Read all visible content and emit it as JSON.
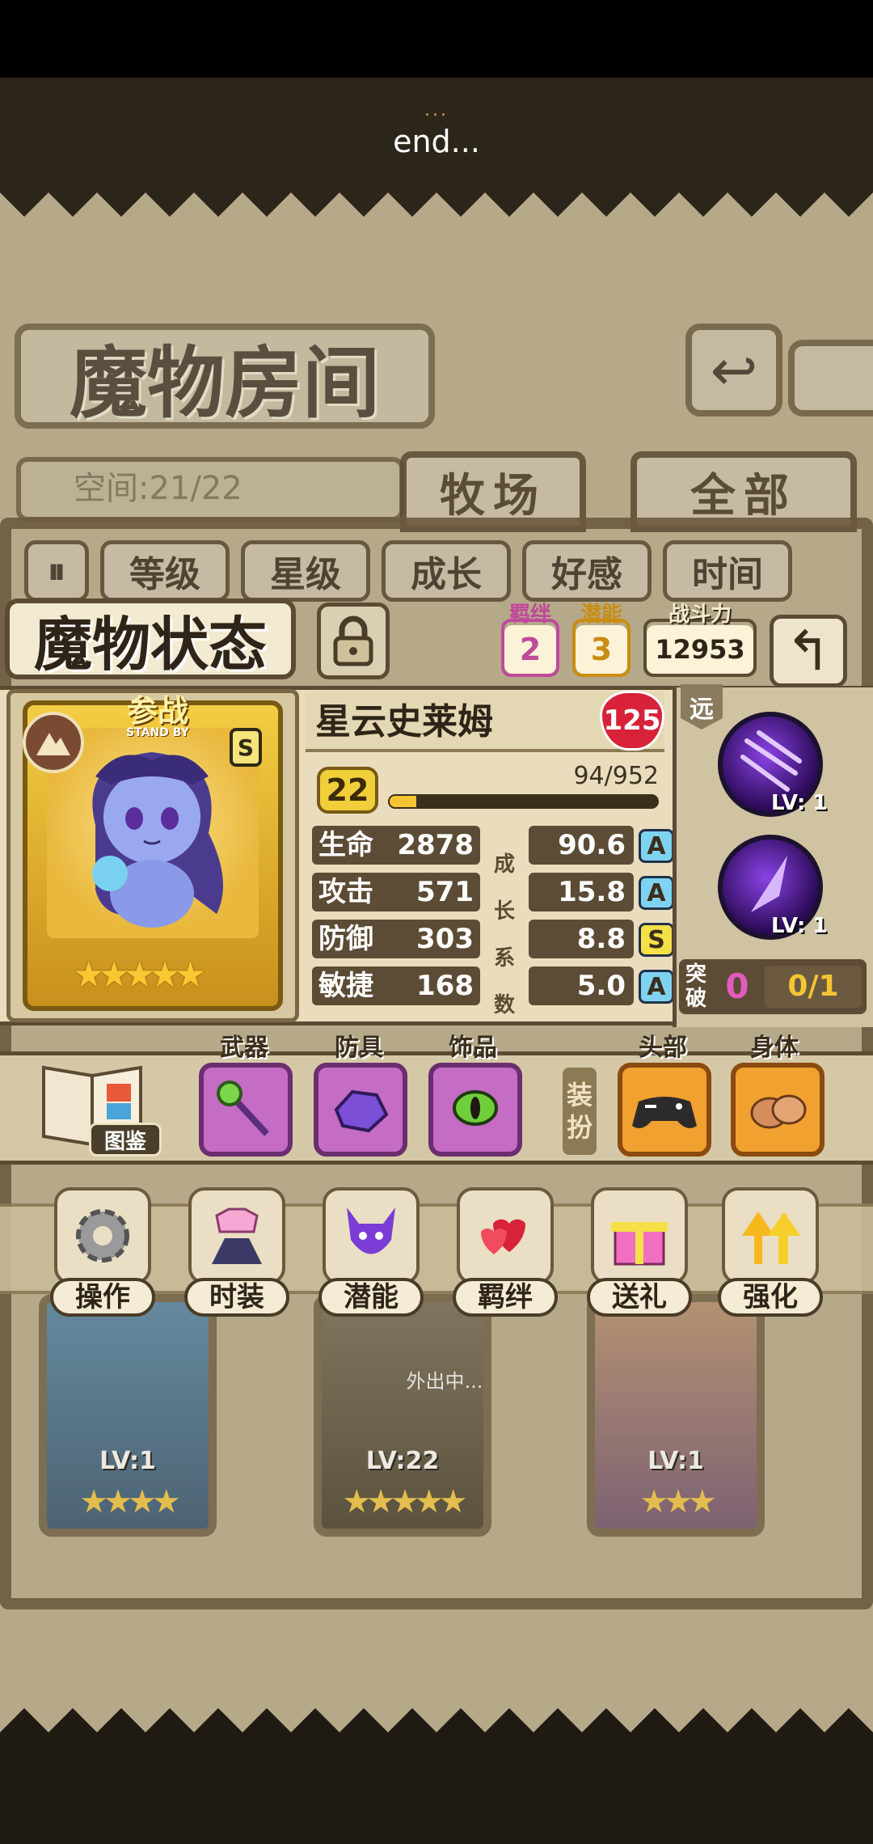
{
  "loading": {
    "dots": "...",
    "text": "end..."
  },
  "room": {
    "title": "魔物房间",
    "space": "空间:21/22",
    "tabs": [
      "牧场",
      "全部"
    ],
    "filters": [
      "等级",
      "星级",
      "成长",
      "好感",
      "时间"
    ]
  },
  "status": {
    "title": "魔物状态",
    "bond_label": "羁绊",
    "bond_value": "2",
    "potential_label": "潜能",
    "potential_value": "3",
    "power_label": "战斗力",
    "power_value": "12953"
  },
  "monster": {
    "name": "星云史莱姆",
    "affection": "125",
    "standby_cn": "参战",
    "standby_en": "STAND BY",
    "rank": "S",
    "stars": 5,
    "level": "22",
    "exp_text": "94/952",
    "exp_fraction": 0.099,
    "growth_label": [
      "成",
      "长",
      "系",
      "数"
    ],
    "stats": [
      {
        "name": "生命",
        "value": "2878",
        "growth": "90.6",
        "grade": "A"
      },
      {
        "name": "攻击",
        "value": "571",
        "growth": "15.8",
        "grade": "A"
      },
      {
        "name": "防御",
        "value": "303",
        "growth": "8.8",
        "grade": "S"
      },
      {
        "name": "敏捷",
        "value": "168",
        "growth": "5.0",
        "grade": "A"
      }
    ]
  },
  "skills": {
    "type": "远",
    "items": [
      {
        "level": "LV: 1"
      },
      {
        "level": "LV: 1"
      }
    ],
    "breakthrough_label": "突破",
    "breakthrough_count": "0",
    "breakthrough_progress": "0/1"
  },
  "equipment": {
    "book_label": "图鉴",
    "slots": [
      "武器",
      "防具",
      "饰品"
    ],
    "dressup_label": [
      "装",
      "扮"
    ],
    "cosmetics": [
      "头部",
      "身体"
    ]
  },
  "actions": [
    "操作",
    "时装",
    "潜能",
    "羁绊",
    "送礼",
    "强化"
  ],
  "roster": [
    {
      "level": "LV:1",
      "stars": 4
    },
    {
      "level": "LV:22",
      "stars": 5,
      "status": "外出中..."
    },
    {
      "level": "LV:1",
      "stars": 3
    }
  ],
  "colors": {
    "grade_A": "#7fd3f0",
    "grade_S": "#f6e047",
    "bond": "#e25bbd",
    "potential": "#f0b31d"
  }
}
